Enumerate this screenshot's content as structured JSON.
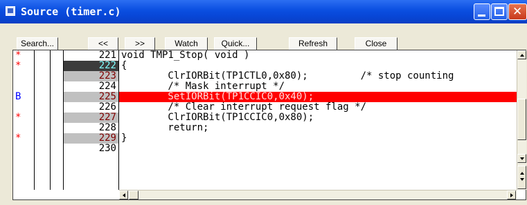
{
  "window": {
    "title": "Source (timer.c)"
  },
  "toolbar": {
    "search_label": "Search...",
    "back_label": "<<",
    "forward_label": ">>",
    "watch_label": "Watch",
    "quick_label": "Quick...",
    "refresh_label": "Refresh",
    "close_label": "Close"
  },
  "markers": [
    {
      "text": "*",
      "color": "#ff0000"
    },
    {
      "text": "*",
      "color": "#ff0000"
    },
    {
      "text": "",
      "color": "#ff0000"
    },
    {
      "text": "",
      "color": "#ff0000"
    },
    {
      "text": "B",
      "color": "#0000ff"
    },
    {
      "text": "",
      "color": "#ff0000"
    },
    {
      "text": "*",
      "color": "#ff0000"
    },
    {
      "text": "",
      "color": "#ff0000"
    },
    {
      "text": "*",
      "color": "#ff0000"
    }
  ],
  "lines": [
    {
      "num": "221",
      "code": "void TMP1_Stop( void )",
      "num_style": "plain",
      "highlight": false
    },
    {
      "num": "222",
      "code": "{",
      "num_style": "current",
      "highlight": false
    },
    {
      "num": "223",
      "code": "        ClrIORBit(TP1CTL0,0x80);         /* stop counting",
      "num_style": "exec",
      "highlight": false
    },
    {
      "num": "224",
      "code": "        /* Mask interrupt */",
      "num_style": "plain",
      "highlight": false
    },
    {
      "num": "225",
      "code": "        SetIORBit(TP1CCIC0,0x40);",
      "num_style": "exec",
      "highlight": true
    },
    {
      "num": "226",
      "code": "        /* Clear interrupt request flag */",
      "num_style": "plain",
      "highlight": false
    },
    {
      "num": "227",
      "code": "        ClrIORBit(TP1CCIC0,0x80);",
      "num_style": "exec",
      "highlight": false
    },
    {
      "num": "228",
      "code": "        return;",
      "num_style": "plain",
      "highlight": false
    },
    {
      "num": "229",
      "code": "}",
      "num_style": "exec",
      "highlight": false
    },
    {
      "num": "230",
      "code": "",
      "num_style": "plain",
      "highlight": false
    }
  ],
  "colors": {
    "highlight_bg": "#ff0000",
    "exec_bg": "#c0c0c0",
    "exec_fg": "#800000",
    "current_bg": "#3c3c3c",
    "current_fg": "#80ffff"
  }
}
